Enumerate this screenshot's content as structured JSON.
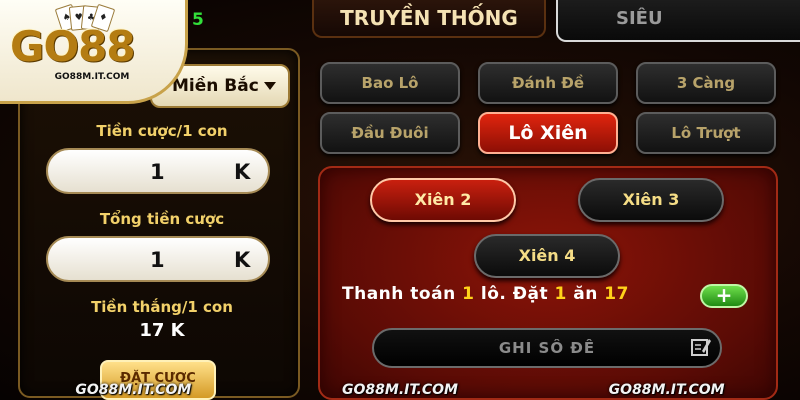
{
  "logo": {
    "brand": "GO88",
    "url": "GO88M.IT.COM"
  },
  "header": {
    "top_number": "5",
    "tab_traditional": "TRUYỀN THỐNG",
    "tab_super": "SIÊU"
  },
  "bet_form": {
    "region": "Miền Bắc",
    "stake_per_number_label": "Tiền cược/1 con",
    "stake_per_number_value": "1",
    "stake_unit": "K",
    "total_stake_label": "Tổng tiền cược",
    "total_stake_value": "1",
    "total_unit": "K",
    "win_per_number_label": "Tiền thắng/1 con",
    "win_per_number_value": "17 K",
    "place_bet_label": "ĐẶT CƯỢC"
  },
  "game_types": [
    {
      "label": "Bao Lô",
      "active": false
    },
    {
      "label": "Đánh Đề",
      "active": false
    },
    {
      "label": "3 Càng",
      "active": false
    },
    {
      "label": "Đầu Đuôi",
      "active": false
    },
    {
      "label": "Lô Xiên",
      "active": true
    },
    {
      "label": "Lô Trượt",
      "active": false
    }
  ],
  "xien_options": [
    {
      "label": "Xiên 2",
      "active": true
    },
    {
      "label": "Xiên 3",
      "active": false
    },
    {
      "label": "Xiên 4",
      "active": false
    }
  ],
  "payout": {
    "p1": "Thanh toán",
    "n1": "1",
    "p2": "lô. Đặt",
    "n2": "1",
    "p3": "ăn",
    "n3": "17"
  },
  "note_input": {
    "placeholder": "GHI SỐ ĐỀ"
  },
  "watermark": [
    "GO88M.IT.COM",
    "GO88M.IT.COM",
    "GO88M.IT.COM"
  ],
  "colors": {
    "accent_gold": "#f2d16a",
    "active_red": "#c9200f",
    "highlight_yellow": "#ffd21a",
    "plus_green": "#3fbf26"
  }
}
